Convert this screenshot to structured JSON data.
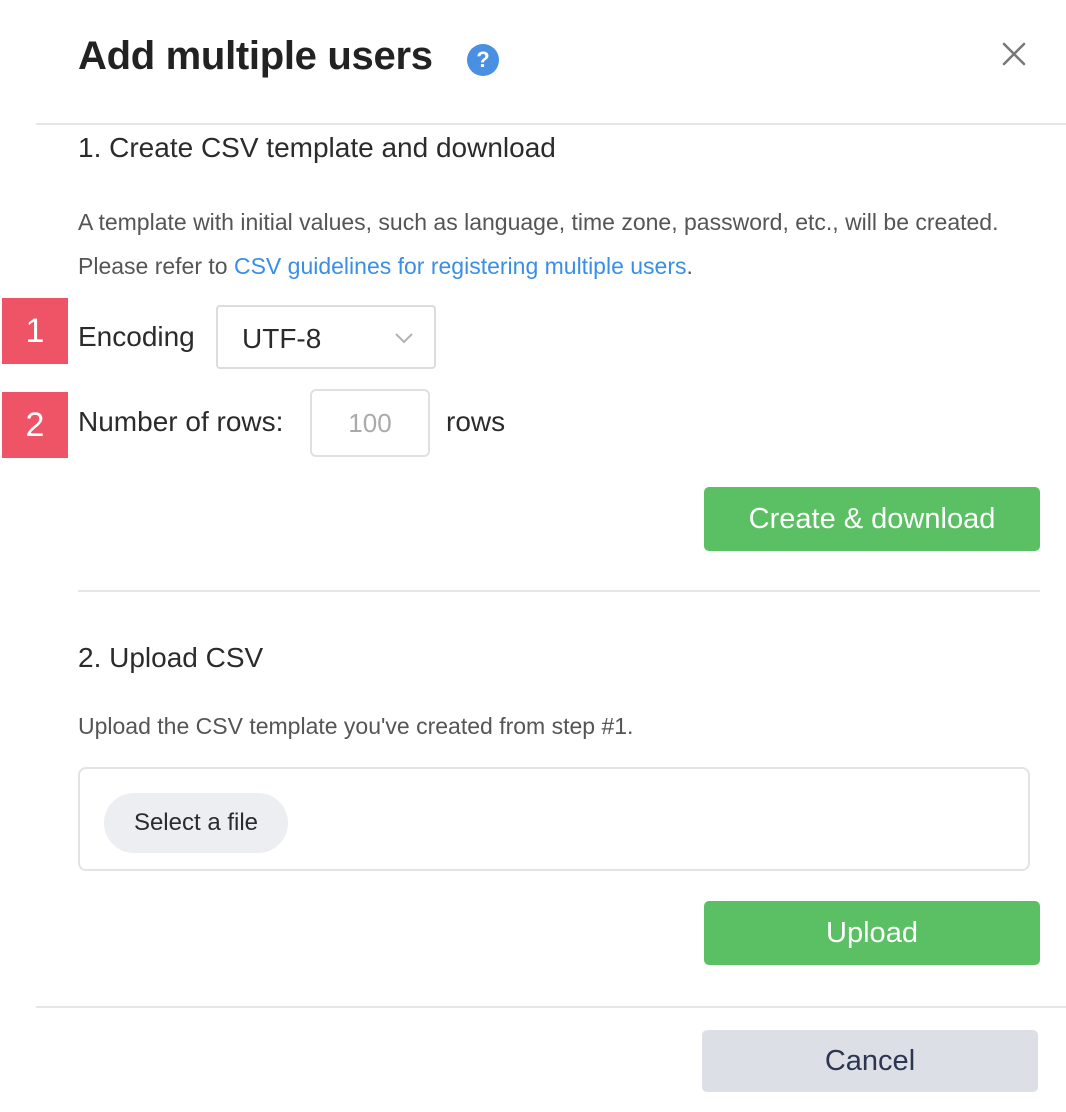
{
  "dialog": {
    "title": "Add multiple users",
    "help_icon": "question-circle-icon",
    "help_glyph": "?",
    "close_icon": "close-icon"
  },
  "step1": {
    "title": "1. Create CSV template and download",
    "description_before_link": "A template with initial values, such as language, time zone, password, etc., will be created. Please refer to ",
    "link_text": "CSV guidelines for registering multiple users",
    "description_after_link": ".",
    "encoding": {
      "marker": "1",
      "label": "Encoding",
      "value": "UTF-8",
      "chevron_icon": "chevron-down-icon"
    },
    "rows": {
      "marker": "2",
      "label": "Number of rows:",
      "placeholder": "100",
      "unit": "rows"
    },
    "create_button": "Create & download"
  },
  "step2": {
    "title": "2. Upload CSV",
    "description": "Upload the CSV template you've created from step #1.",
    "select_file_button": "Select a file",
    "upload_button": "Upload"
  },
  "footer": {
    "cancel_button": "Cancel"
  },
  "colors": {
    "primary_green": "#5bbf63",
    "link_blue": "#3a8fe4",
    "marker_red": "#ee5366",
    "cancel_gray": "#dcdfe6"
  }
}
